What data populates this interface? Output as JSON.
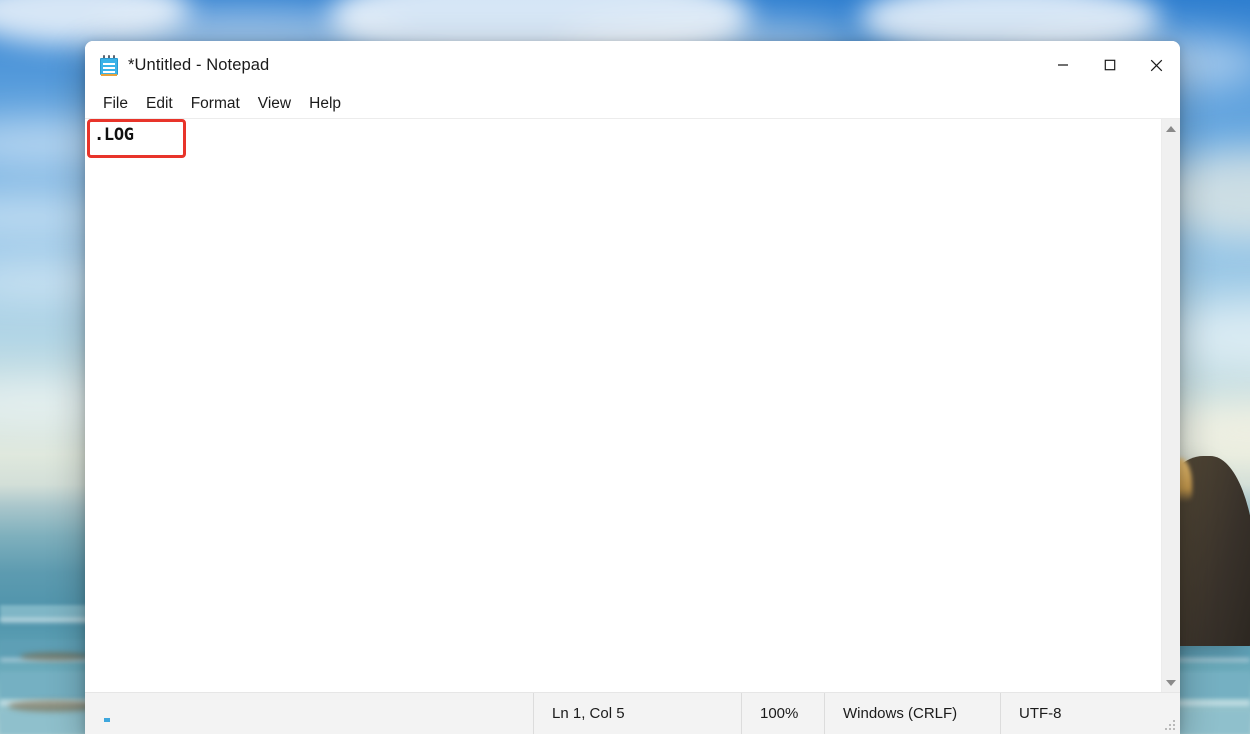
{
  "desktop": {
    "wallpaper_description": "beach-ocean-sea-stack-wallpaper",
    "sky_color": "#4d95d9",
    "water_color": "#5d9bb0",
    "rock_color": "#4e4434"
  },
  "window": {
    "icon_name": "notepad-icon",
    "title": "*Untitled - Notepad",
    "controls": {
      "minimize_label": "Minimize",
      "maximize_label": "Maximize",
      "close_label": "Close"
    }
  },
  "menu": {
    "items": [
      {
        "label": "File"
      },
      {
        "label": "Edit"
      },
      {
        "label": "Format"
      },
      {
        "label": "View"
      },
      {
        "label": "Help"
      }
    ]
  },
  "editor": {
    "content": ".LOG",
    "placeholder": "",
    "annotation": {
      "shape": "rectangle",
      "color": "#e8342a",
      "target": ".LOG"
    }
  },
  "scrollbar": {
    "up_icon": "triangle-up-icon",
    "down_icon": "triangle-down-icon"
  },
  "status_bar": {
    "position": "Ln 1, Col 5",
    "zoom": "100%",
    "line_ending": "Windows (CRLF)",
    "encoding": "UTF-8"
  }
}
